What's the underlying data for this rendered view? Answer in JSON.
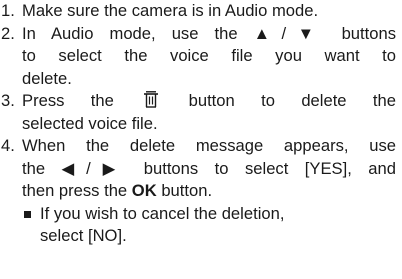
{
  "steps": [
    {
      "number": "1.",
      "lines": [
        "Make sure the camera is in Audio mode."
      ]
    },
    {
      "number": "2.",
      "line1": "In Audio mode, use the ▲/▼ buttons",
      "line2": "to select the voice file you want to",
      "line3": "delete."
    },
    {
      "number": "3.",
      "line1_pre": "Press the",
      "line1_post": "button to delete the",
      "line2": "selected voice file.",
      "icon": "trash-icon"
    },
    {
      "number": "4.",
      "line1": "When the delete message appears, use",
      "line2": "the ◀/▶ buttons to select [YES], and",
      "line3_pre": "then press the",
      "line3_bold": "OK",
      "line3_post": "button."
    }
  ],
  "bullet": {
    "line1": "If you wish to cancel the deletion,",
    "line2": "select [NO]."
  }
}
